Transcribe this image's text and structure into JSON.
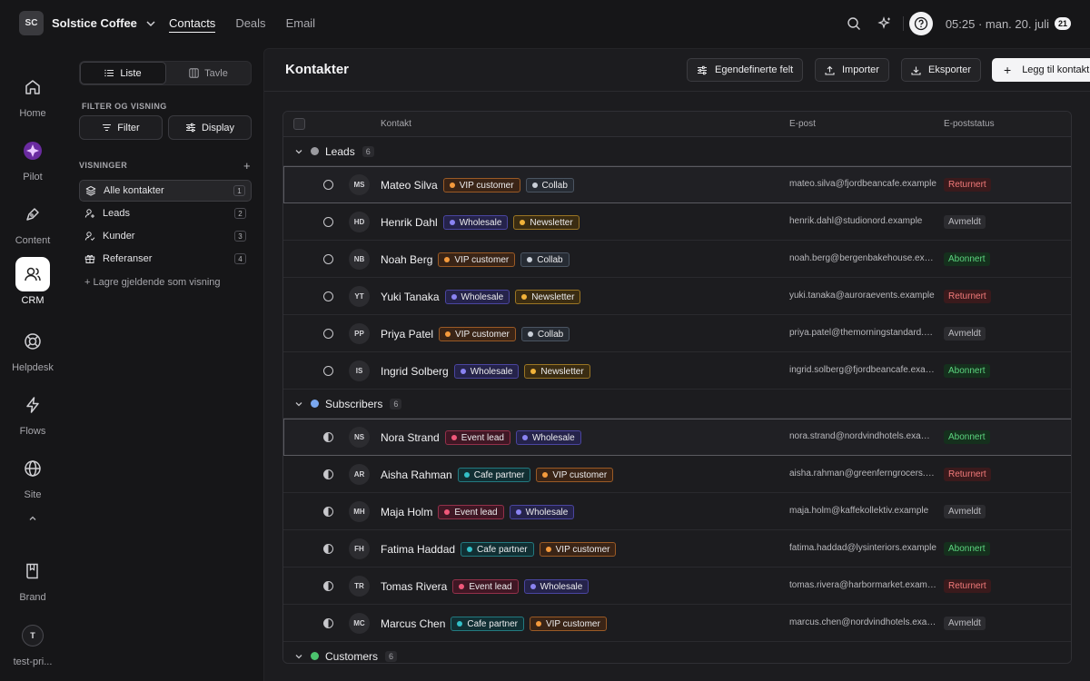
{
  "workspace": {
    "initials": "SC",
    "name": "Solstice Coffee"
  },
  "topnav": [
    {
      "label": "Contacts",
      "active": true
    },
    {
      "label": "Deals",
      "active": false
    },
    {
      "label": "Email",
      "active": false
    }
  ],
  "clock": {
    "time": "05:25 · man. 20. juli",
    "badge": "21"
  },
  "rail": [
    {
      "label": "Home",
      "icon": "home-icon"
    },
    {
      "label": "Pilot",
      "icon": "pilot-icon"
    },
    {
      "label": "Content",
      "icon": "pen-icon"
    },
    {
      "label": "CRM",
      "icon": "users-icon",
      "active": true
    },
    {
      "label": "Helpdesk",
      "icon": "lifebuoy-icon"
    },
    {
      "label": "Flows",
      "icon": "bolt-icon"
    },
    {
      "label": "Site",
      "icon": "globe-icon"
    },
    {
      "label": "Brand",
      "icon": "book-icon"
    },
    {
      "label": "test-pri...",
      "initial": "T",
      "icon": "avatar"
    }
  ],
  "sidebar": {
    "seg": [
      "Liste",
      "Tavle"
    ],
    "filter_heading": "FILTER OG VISNING",
    "filter_btn": "Filter",
    "display_btn": "Display",
    "views_heading": "VISNINGER",
    "views": [
      {
        "label": "Alle kontakter",
        "count": "1",
        "active": true
      },
      {
        "label": "Leads",
        "count": "2"
      },
      {
        "label": "Kunder",
        "count": "3"
      },
      {
        "label": "Referanser",
        "count": "4"
      }
    ],
    "save_view": "+ Lagre gjeldende som visning"
  },
  "header": {
    "title": "Kontakter",
    "custom_fields": "Egendefinerte felt",
    "import": "Importer",
    "export": "Eksporter",
    "add": "Legg til kontakt"
  },
  "table": {
    "columns": {
      "contact": "Kontakt",
      "email": "E-post",
      "status": "E-poststatus"
    },
    "groups": [
      {
        "name": "Leads",
        "count": "6",
        "color": "#9a9a9f",
        "rows": [
          {
            "initials": "MS",
            "name": "Mateo Silva",
            "tags": [
              "VIP customer",
              "Collab"
            ],
            "email": "mateo.silva@fjordbeancafe.example",
            "status": "Returnert",
            "selected": true
          },
          {
            "initials": "HD",
            "name": "Henrik Dahl",
            "tags": [
              "Wholesale",
              "Newsletter"
            ],
            "email": "henrik.dahl@studionord.example",
            "status": "Avmeldt"
          },
          {
            "initials": "NB",
            "name": "Noah Berg",
            "tags": [
              "VIP customer",
              "Collab"
            ],
            "email": "noah.berg@bergenbakehouse.example",
            "status": "Abonnert"
          },
          {
            "initials": "YT",
            "name": "Yuki Tanaka",
            "tags": [
              "Wholesale",
              "Newsletter"
            ],
            "email": "yuki.tanaka@auroraevents.example",
            "status": "Returnert"
          },
          {
            "initials": "PP",
            "name": "Priya Patel",
            "tags": [
              "VIP customer",
              "Collab"
            ],
            "email": "priya.patel@themorningstandard.example",
            "status": "Avmeldt"
          },
          {
            "initials": "IS",
            "name": "Ingrid Solberg",
            "tags": [
              "Wholesale",
              "Newsletter"
            ],
            "email": "ingrid.solberg@fjordbeancafe.example",
            "status": "Abonnert"
          }
        ]
      },
      {
        "name": "Subscribers",
        "count": "6",
        "color": "#7aa7f0",
        "rows": [
          {
            "initials": "NS",
            "name": "Nora Strand",
            "tags": [
              "Event lead",
              "Wholesale"
            ],
            "email": "nora.strand@nordvindhotels.example",
            "status": "Abonnert",
            "selected": true
          },
          {
            "initials": "AR",
            "name": "Aisha Rahman",
            "tags": [
              "Cafe partner",
              "VIP customer"
            ],
            "email": "aisha.rahman@greenferngrocers.example",
            "status": "Returnert"
          },
          {
            "initials": "MH",
            "name": "Maja Holm",
            "tags": [
              "Event lead",
              "Wholesale"
            ],
            "email": "maja.holm@kaffekollektiv.example",
            "status": "Avmeldt"
          },
          {
            "initials": "FH",
            "name": "Fatima Haddad",
            "tags": [
              "Cafe partner",
              "VIP customer"
            ],
            "email": "fatima.haddad@lysinteriors.example",
            "status": "Abonnert"
          },
          {
            "initials": "TR",
            "name": "Tomas Rivera",
            "tags": [
              "Event lead",
              "Wholesale"
            ],
            "email": "tomas.rivera@harbormarket.example",
            "status": "Returnert"
          },
          {
            "initials": "MC",
            "name": "Marcus Chen",
            "tags": [
              "Cafe partner",
              "VIP customer"
            ],
            "email": "marcus.chen@nordvindhotels.example",
            "status": "Avmeldt"
          }
        ]
      },
      {
        "name": "Customers",
        "count": "6",
        "color": "#4cc36e",
        "rows": []
      }
    ]
  },
  "tag_colors": {
    "VIP customer": {
      "dot": "#f59a3c",
      "bg": "#3a2416",
      "border": "#9a5a26"
    },
    "Collab": {
      "dot": "#c9cfd8",
      "bg": "#262b33",
      "border": "#4b5562"
    },
    "Wholesale": {
      "dot": "#8a83f2",
      "bg": "#25234a",
      "border": "#4a45a0"
    },
    "Newsletter": {
      "dot": "#f2b33a",
      "bg": "#3a2c12",
      "border": "#9a7524"
    },
    "Event lead": {
      "dot": "#f0587a",
      "bg": "#3f1724",
      "border": "#93304a"
    },
    "Cafe partner": {
      "dot": "#33c0c8",
      "bg": "#112f33",
      "border": "#237a80"
    }
  },
  "status_colors": {
    "Returnert": {
      "bg": "#3a1a1c",
      "fg": "#f27a7a"
    },
    "Avmeldt": {
      "bg": "#2c2c30",
      "fg": "#bdbdc2"
    },
    "Abonnert": {
      "bg": "#15301d",
      "fg": "#5cd47f"
    }
  }
}
